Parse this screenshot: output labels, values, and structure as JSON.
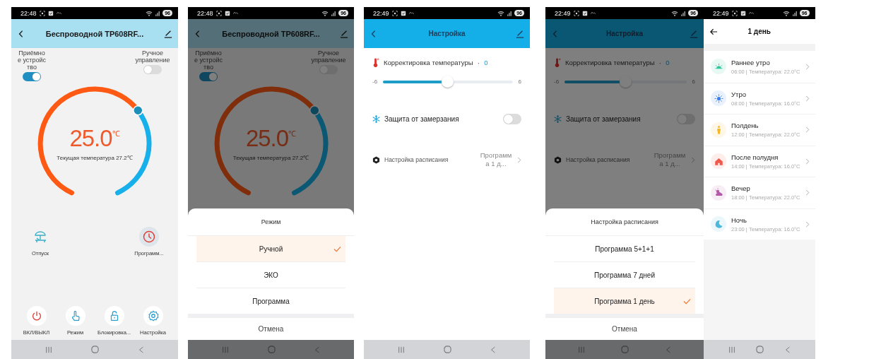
{
  "screens": [
    {
      "kind": "home",
      "status": {
        "time": "22:48",
        "battery": "96"
      },
      "header": {
        "title": "Беспроводной TP608RF..."
      },
      "toggles": [
        {
          "label": "Приёмное устройство",
          "on": true
        },
        {
          "label": "Ручное управление",
          "on": false
        }
      ],
      "dial": {
        "setpoint": "25.0",
        "unit": "℃",
        "current": "Текущая температура 27.2℃"
      },
      "shortcuts": [
        {
          "kind": "vacation",
          "label": "Отпуск",
          "active": false
        },
        {
          "kind": "schedule",
          "label": "Программ...",
          "active": true
        }
      ],
      "buttons": [
        {
          "kind": "power",
          "label": "ВКЛ/ВЫКЛ"
        },
        {
          "kind": "mode",
          "label": "Режим"
        },
        {
          "kind": "lock",
          "label": "Блокировка..."
        },
        {
          "kind": "settings",
          "label": "Настройка"
        }
      ]
    },
    {
      "kind": "home",
      "status": {
        "time": "22:48",
        "battery": "96"
      },
      "header": {
        "title": "Беспроводной TP608RF..."
      },
      "toggles": [
        {
          "label": "Приёмное устройство",
          "on": true
        },
        {
          "label": "Ручное управление",
          "on": false
        }
      ],
      "dial": {
        "setpoint": "25.0",
        "unit": "℃",
        "current": "Текущая температура 27.2℃"
      },
      "sheet": {
        "title": "Режим",
        "options": [
          {
            "label": "Ручной",
            "selected": true
          },
          {
            "label": "ЭКО",
            "selected": false
          },
          {
            "label": "Программа",
            "selected": false
          }
        ],
        "cancel": "Отмена"
      }
    },
    {
      "kind": "settings",
      "status": {
        "time": "22:49",
        "battery": "96"
      },
      "header": {
        "title": "Настройка"
      },
      "correction": {
        "label": "Корректировка температуры",
        "separator": "·",
        "value": "0"
      },
      "slider": {
        "min": "-6",
        "max": "6",
        "level": 0.5
      },
      "frost": {
        "label": "Защита от замерзания",
        "on": false
      },
      "schedule": {
        "label": "Настройка расписания",
        "value": "Программа 1 д..."
      }
    },
    {
      "kind": "settings",
      "status": {
        "time": "22:49",
        "battery": "96"
      },
      "header": {
        "title": "Настройка"
      },
      "correction": {
        "label": "Корректировка температуры",
        "separator": "·",
        "value": "0"
      },
      "slider": {
        "min": "-6",
        "max": "6",
        "level": 0.5
      },
      "frost": {
        "label": "Защита от замерзания",
        "on": false
      },
      "schedule": {
        "label": "Настройка расписания",
        "value": "Программа 1 д..."
      },
      "sheet": {
        "title": "Настройка расписания",
        "options": [
          {
            "label": "Программа 5+1+1",
            "selected": false
          },
          {
            "label": "Программа 7 дней",
            "selected": false
          },
          {
            "label": "Программа 1 день",
            "selected": true
          }
        ],
        "cancel": "Отмена"
      }
    },
    {
      "kind": "day",
      "status": {
        "time": "22:49",
        "battery": "96"
      },
      "header": {
        "title": "1 день"
      },
      "periods": [
        {
          "kind": "sunrise",
          "color": "#2fc59a",
          "title": "Раннее утро",
          "detail": "06:00 | Температура: 22.0°C"
        },
        {
          "kind": "sun",
          "color": "#3a7ef0",
          "title": "Утро",
          "detail": "08:00 | Температура: 16.0°C"
        },
        {
          "kind": "person",
          "color": "#f5b82a",
          "title": "Полдень",
          "detail": "12:00 | Температура: 22.0°C"
        },
        {
          "kind": "house",
          "color": "#f0584a",
          "title": "После полудня",
          "detail": "14:00 | Температура: 16.0°C"
        },
        {
          "kind": "cloud",
          "color": "#b45aa8",
          "title": "Вечер",
          "detail": "18:00 | Температура: 22.0°C"
        },
        {
          "kind": "moon",
          "color": "#4cb8dc",
          "title": "Ночь",
          "detail": "23:00 | Температура: 16.0°C"
        }
      ]
    }
  ]
}
